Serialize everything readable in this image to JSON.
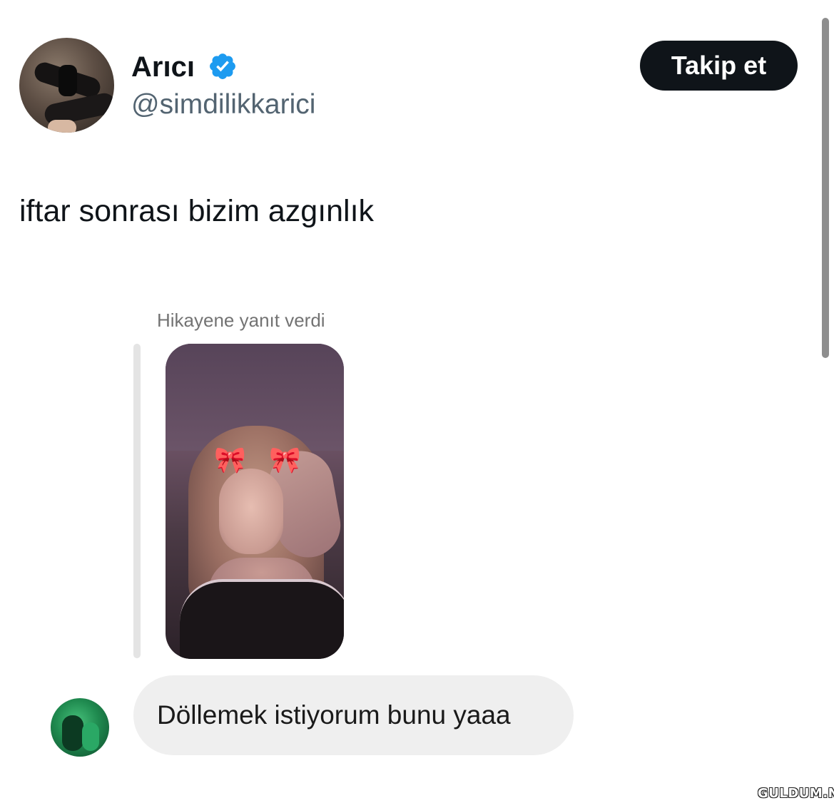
{
  "tweet": {
    "author": {
      "display_name": "Arıcı",
      "handle": "@simdilikkarici",
      "verified": true,
      "verified_icon": "verified-badge-icon",
      "avatar": "profile-avatar"
    },
    "follow_button_label": "Takip et",
    "text": "iftar sonrası bizim azgınlık"
  },
  "embedded_screenshot": {
    "reply_label": "Hikayene yanıt verdi",
    "story_image": "story-photo",
    "message": {
      "sender_avatar": "sender-avatar",
      "text": "Döllemek istiyorum bunu yaaa"
    }
  },
  "watermark": "GULDUM.NET",
  "colors": {
    "text_primary": "#0f1419",
    "text_secondary": "#536471",
    "verified_blue": "#1d9bf0",
    "follow_button_bg": "#0f1419",
    "bubble_bg": "#efefef"
  }
}
